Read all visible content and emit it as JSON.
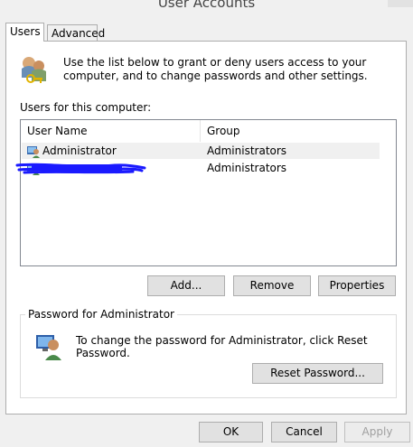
{
  "window": {
    "title": "User Accounts"
  },
  "tabs": [
    {
      "label": "Users",
      "active": true
    },
    {
      "label": "Advanced",
      "active": false
    }
  ],
  "intro": {
    "text": "Use the list below to grant or deny users access to your computer, and to change passwords and other settings.",
    "icon": "users-icon"
  },
  "users_section": {
    "label": "Users for this computer:",
    "columns": [
      "User Name",
      "Group"
    ],
    "rows": [
      {
        "user": "Administrator",
        "group": "Administrators",
        "icon": "user-icon"
      },
      {
        "user": "",
        "group": "Administrators",
        "icon": "user-icon"
      }
    ]
  },
  "list_buttons": {
    "add": "Add...",
    "remove": "Remove",
    "properties": "Properties"
  },
  "password_section": {
    "label": "Password for Administrator",
    "text": "To change the password for Administrator, click Reset Password.",
    "reset_button": "Reset Password...",
    "icon": "password-user-icon"
  },
  "dialog_buttons": {
    "ok": "OK",
    "cancel": "Cancel",
    "apply": "Apply"
  },
  "colors": {
    "redaction": "#1a1aff",
    "panel_border": "#adadad",
    "button_face": "#e1e1e1"
  }
}
